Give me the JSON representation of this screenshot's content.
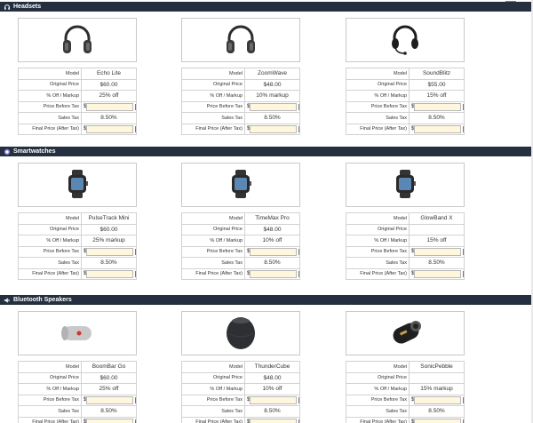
{
  "sections": [
    {
      "title": "Headsets",
      "icon": "headphones-icon",
      "products": [
        {
          "icon": "over-ear-headphones-icon",
          "name": "Echo Lite",
          "original": "$60.00",
          "offmarkup": "25% off",
          "tax": "8.50%"
        },
        {
          "icon": "over-ear-headphones-icon",
          "name": "ZoomWave",
          "original": "$48.00",
          "offmarkup": "10% markup",
          "tax": "8.50%"
        },
        {
          "icon": "headset-with-mic-icon",
          "name": "SoundBlitz",
          "original": "$55.00",
          "offmarkup": "15% off",
          "tax": "8.50%"
        }
      ]
    },
    {
      "title": "Smartwatches",
      "icon": "watch-icon",
      "products": [
        {
          "icon": "smartwatch-icon",
          "name": "PulseTrack Mini",
          "original": "$60.00",
          "offmarkup": "25% markup",
          "tax": "8.50%"
        },
        {
          "icon": "smartwatch-icon",
          "name": "TimeMax Pro",
          "original": "$48.00",
          "offmarkup": "10% off",
          "tax": "8.50%"
        },
        {
          "icon": "smartwatch-icon",
          "name": "GlowBand X",
          "original": "",
          "offmarkup": "15% off",
          "tax": "8.50%"
        }
      ]
    },
    {
      "title": "Bluetooth Speakers",
      "icon": "speaker-icon",
      "products": [
        {
          "icon": "cylinder-speaker-icon",
          "name": "BoomBar Go",
          "original": "$60.00",
          "offmarkup": "25% off",
          "tax": "8.50%"
        },
        {
          "icon": "round-speaker-icon",
          "name": "ThunderCube",
          "original": "$48.00",
          "offmarkup": "10% off",
          "tax": "8.50%"
        },
        {
          "icon": "lantern-speaker-icon",
          "name": "SonicPebble",
          "original": "",
          "offmarkup": "15% markup",
          "tax": "8.50%"
        }
      ]
    }
  ],
  "labels": {
    "model": "Model",
    "original": "Original Price",
    "offmarkup": "% Off / Markup",
    "before_tax": "Price Before Tax",
    "sales_tax": "Sales Tax",
    "final": "Final Price (After Tax)",
    "currency": "$"
  },
  "colors": {
    "header_bg": "#24303f",
    "input_bg": "#fff7dd",
    "border": "#d2d2d2"
  }
}
